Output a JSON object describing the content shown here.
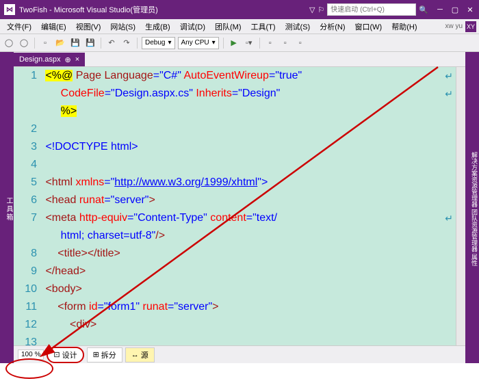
{
  "title": "TwoFish - Microsoft Visual Studio(管理员)",
  "quick_launch_placeholder": "快速启动 (Ctrl+Q)",
  "user_name": "xw yu",
  "user_initials": "XY",
  "menus": [
    "文件(F)",
    "编辑(E)",
    "视图(V)",
    "网站(S)",
    "生成(B)",
    "调试(D)",
    "团队(M)",
    "工具(T)",
    "测试(S)",
    "分析(N)",
    "窗口(W)",
    "帮助(H)"
  ],
  "toolbar": {
    "config": "Debug",
    "platform": "Any CPU"
  },
  "tab": {
    "name": "Design.aspx",
    "pinned": "⊕",
    "close": "×"
  },
  "zoom": "100 %",
  "bottom_tabs": {
    "design": "设计",
    "split": "拆分",
    "source": "源"
  },
  "right_strip": "解决方案资源管理器  团队资源管理器  属性",
  "left_strip": "工具箱",
  "code": {
    "l1a": "<%@",
    "l1b": " Page Language",
    "l1c": "=\"C#\"",
    "l1d": " AutoEventWireup",
    "l1e": "=\"true\"",
    "l1f": "CodeFile",
    "l1g": "=\"Design.aspx.cs\"",
    "l1h": " Inherits",
    "l1i": "=\"Design\"",
    "l1j": "%>",
    "l3": "<!DOCTYPE html>",
    "l5a": "<html ",
    "l5b": "xmlns",
    "l5c": "=\"",
    "l5d": "http://www.w3.org/1999/xhtml",
    "l5e": "\">",
    "l6a": "<head ",
    "l6b": "runat",
    "l6c": "=\"server\"",
    "l7a": "<meta ",
    "l7b": "http-equiv",
    "l7c": "=\"Content-Type\"",
    "l7d": " content",
    "l7e": "=\"text/",
    "l7f": "html; charset=utf-8\"",
    "l7g": "/>",
    "l8a": "<title>",
    "l8b": "</title>",
    "l9": "</head>",
    "l10": "<body>",
    "l11a": "<form ",
    "l11b": "id",
    "l11c": "=\"form1\"",
    "l11d": " runat",
    "l11e": "=\"server\"",
    "l12": "<div>"
  },
  "lines": [
    "1",
    "2",
    "3",
    "4",
    "5",
    "6",
    "7",
    "8",
    "9",
    "10",
    "11",
    "12",
    "13"
  ]
}
